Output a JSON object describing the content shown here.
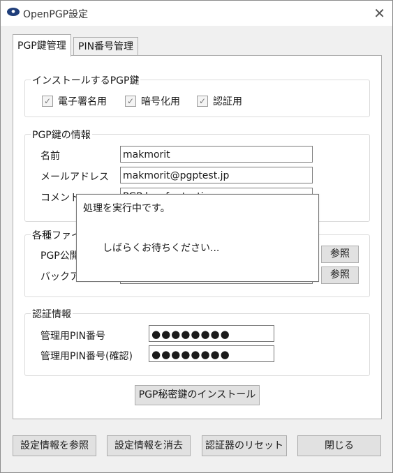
{
  "window": {
    "title": "OpenPGP設定",
    "icon": "app-logo-icon",
    "close_label": "✕"
  },
  "tabs": [
    {
      "label": "PGP鍵管理",
      "active": true
    },
    {
      "label": "PIN番号管理",
      "active": false
    }
  ],
  "install_keys": {
    "legend": "インストールするPGP鍵",
    "items": [
      {
        "label": "電子署名用",
        "checked": true
      },
      {
        "label": "暗号化用",
        "checked": true
      },
      {
        "label": "認証用",
        "checked": true
      }
    ]
  },
  "key_info": {
    "legend": "PGP鍵の情報",
    "name_label": "名前",
    "name_value": "makmorit",
    "email_label": "メールアドレス",
    "email_value": "makmorit@pgptest.jp",
    "comment_label": "コメント",
    "comment_value": "PGP key for testing"
  },
  "files": {
    "legend": "各種ファイル",
    "pubkey_label": "PGP公開",
    "backup_label": "バックアップ",
    "browse_label": "参照"
  },
  "auth": {
    "legend": "認証情報",
    "pin_label": "管理用PIN番号",
    "pin_confirm_label": "管理用PIN番号(確認)",
    "pin_mask": "●●●●●●●●",
    "pin_confirm_mask": "●●●●●●●●"
  },
  "install_button": "PGP秘密鍵のインストール",
  "bottom_buttons": {
    "view": "設定情報を参照",
    "erase": "設定情報を消去",
    "reset": "認証器のリセット",
    "close": "閉じる"
  },
  "dialog": {
    "title": "処理を実行中です。",
    "message": "しばらくお待ちください..."
  }
}
